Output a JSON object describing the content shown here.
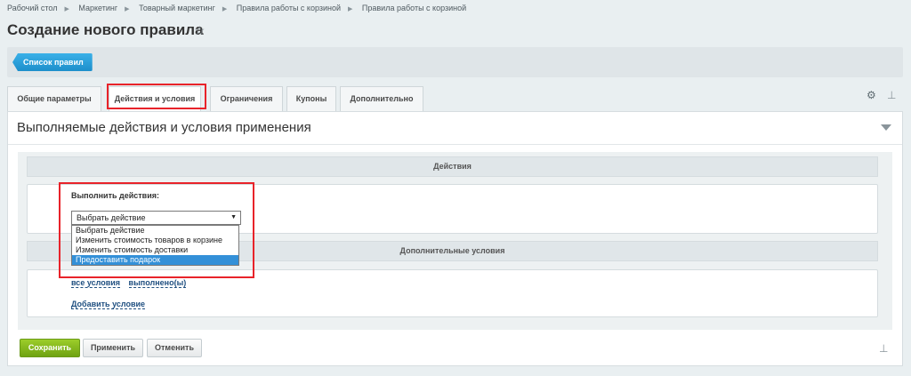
{
  "breadcrumb": [
    "Рабочий стол",
    "Маркетинг",
    "Товарный маркетинг",
    "Правила работы с корзиной",
    "Правила работы с корзиной"
  ],
  "page": {
    "title": "Создание нового правила"
  },
  "toolbar": {
    "list_button": "Список правил"
  },
  "tabs": [
    "Общие параметры",
    "Действия и условия",
    "Ограничения",
    "Купоны",
    "Дополнительно"
  ],
  "active_tab": "Действия и условия",
  "panel": {
    "title": "Выполняемые действия и условия применения"
  },
  "actions": {
    "header": "Действия",
    "label": "Выполнить действия:",
    "selected": "Выбрать действие",
    "options": [
      "Выбрать действие",
      "Изменить стоимость товаров в корзине",
      "Изменить стоимость доставки",
      "Предоставить подарок"
    ],
    "highlighted_option": "Предоставить подарок"
  },
  "conditions": {
    "header": "Дополнительные условия",
    "link_all": "все условия",
    "link_done": "выполнено(ы)",
    "add_label": "Добавить условие"
  },
  "buttons": {
    "save": "Сохранить",
    "apply": "Применить",
    "cancel": "Отменить"
  },
  "colors": {
    "accent": "#1d8fcb",
    "save": "#7ab317",
    "highlight": "#e8232a",
    "selection": "#3390d8"
  },
  "icons": {
    "star": "star-icon",
    "gear": "gear-icon",
    "pin": "pin-icon",
    "collapse": "collapse-icon"
  }
}
